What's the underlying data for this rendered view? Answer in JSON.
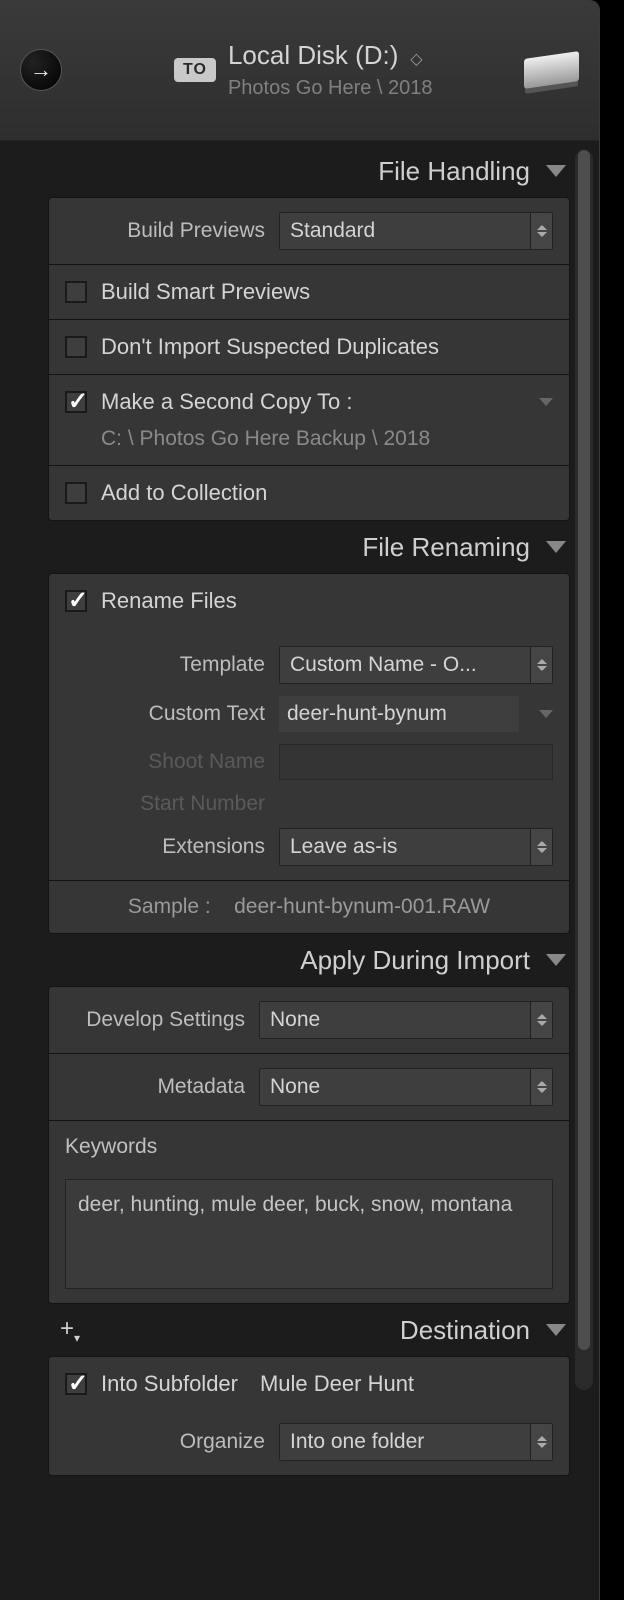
{
  "header": {
    "to_badge": "TO",
    "destination_title": "Local Disk (D:)",
    "destination_path": "Photos Go Here \\ 2018"
  },
  "file_handling": {
    "title": "File Handling",
    "build_previews_label": "Build Previews",
    "build_previews_value": "Standard",
    "smart_previews_label": "Build Smart Previews",
    "smart_previews_checked": false,
    "no_duplicates_label": "Don't Import Suspected Duplicates",
    "no_duplicates_checked": false,
    "second_copy_label": "Make a Second Copy To :",
    "second_copy_checked": true,
    "second_copy_path": "C: \\ Photos Go Here Backup \\ 2018",
    "add_collection_label": "Add to Collection",
    "add_collection_checked": false
  },
  "file_renaming": {
    "title": "File Renaming",
    "rename_label": "Rename Files",
    "rename_checked": true,
    "template_label": "Template",
    "template_value": "Custom Name - O...",
    "custom_text_label": "Custom Text",
    "custom_text_value": "deer-hunt-bynum",
    "shoot_name_label": "Shoot Name",
    "start_number_label": "Start Number",
    "extensions_label": "Extensions",
    "extensions_value": "Leave as-is",
    "sample_label": "Sample :",
    "sample_value": "deer-hunt-bynum-001.RAW"
  },
  "apply_during_import": {
    "title": "Apply During Import",
    "develop_label": "Develop Settings",
    "develop_value": "None",
    "metadata_label": "Metadata",
    "metadata_value": "None",
    "keywords_label": "Keywords",
    "keywords_value": "deer, hunting, mule deer, buck, snow, montana"
  },
  "destination": {
    "title": "Destination",
    "into_subfolder_label": "Into Subfolder",
    "into_subfolder_checked": true,
    "subfolder_name": "Mule Deer Hunt",
    "organize_label": "Organize",
    "organize_value": "Into one folder"
  }
}
